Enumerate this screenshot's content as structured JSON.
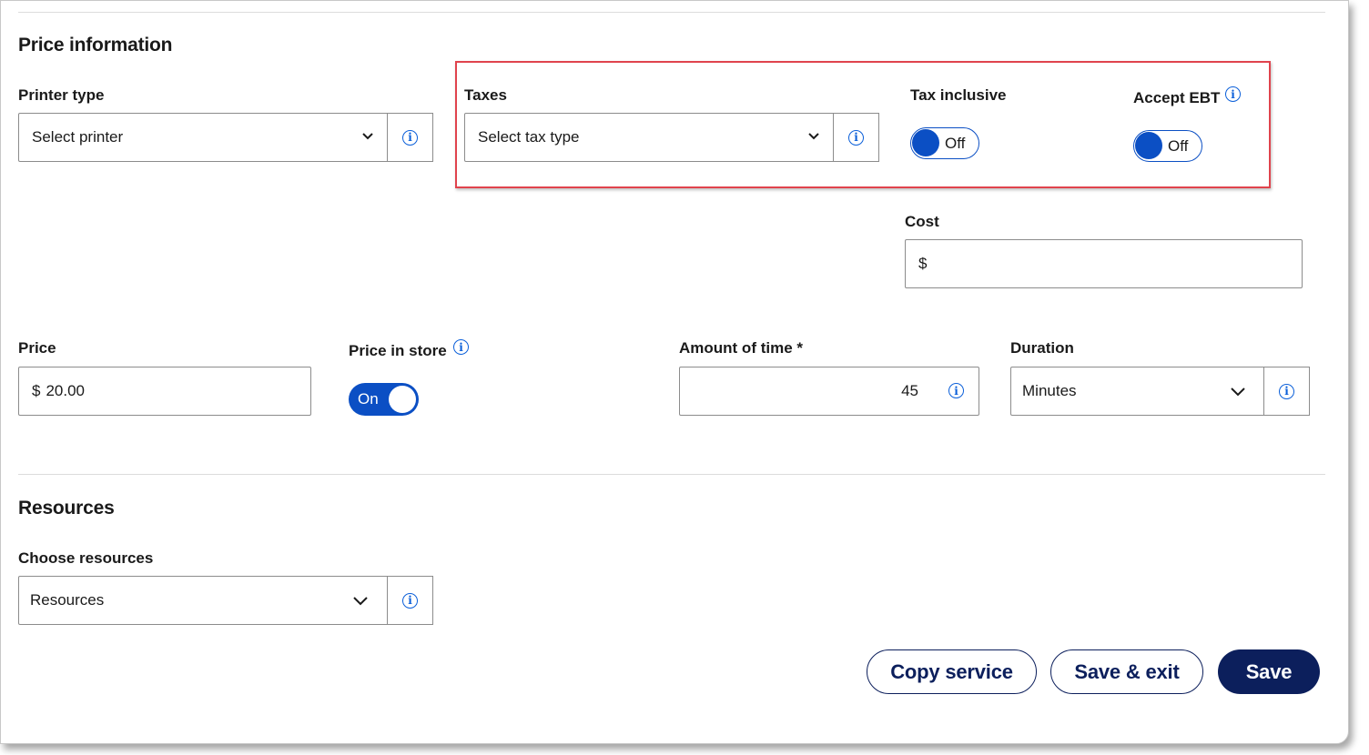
{
  "price_section": {
    "title": "Price information",
    "printer_type": {
      "label": "Printer type",
      "value": "Select printer"
    },
    "taxes": {
      "label": "Taxes",
      "value": "Select tax type"
    },
    "tax_inclusive": {
      "label": "Tax inclusive",
      "state": "Off"
    },
    "accept_ebt": {
      "label": "Accept EBT",
      "state": "Off"
    },
    "cost": {
      "label": "Cost",
      "prefix": "$",
      "value": ""
    },
    "price": {
      "label": "Price",
      "prefix": "$",
      "value": "20.00"
    },
    "price_in_store": {
      "label": "Price in store",
      "state": "On"
    },
    "amount_of_time": {
      "label": "Amount of time *",
      "value": "45"
    },
    "duration": {
      "label": "Duration",
      "value": "Minutes"
    }
  },
  "resources_section": {
    "title": "Resources",
    "choose_resources": {
      "label": "Choose resources",
      "value": "Resources"
    }
  },
  "actions": {
    "copy_label": "Copy service",
    "save_exit_label": "Save & exit",
    "save_label": "Save"
  },
  "icons": {
    "info": "info-circle-icon",
    "chevron": "chevron-down-icon"
  },
  "colors": {
    "accent": "#0b4fc4",
    "info": "#0b5fd9",
    "button_dark": "#0c1f5c",
    "highlight": "#e0434d"
  }
}
